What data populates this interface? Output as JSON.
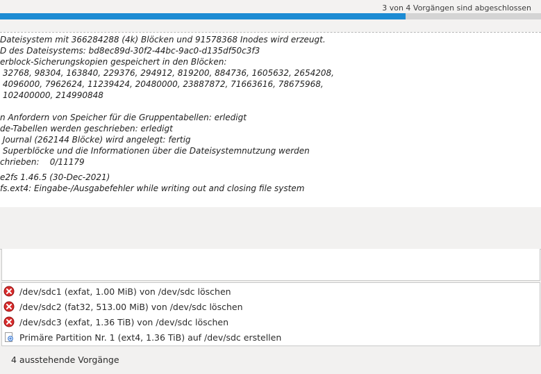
{
  "progress": {
    "status_text": "3 von 4 Vorgängen sind abgeschlossen",
    "fraction": 0.75,
    "color": "#1c8bd3"
  },
  "log": {
    "lines": [
      "Dateisystem mit 366284288 (4k) Blöcken und 91578368 Inodes wird erzeugt.",
      "D des Dateisystems: bd8ec89d-30f2-44bc-9ac0-d135df50c3f3",
      "erblock-Sicherungskopien gespeichert in den Blöcken:",
      " 32768, 98304, 163840, 229376, 294912, 819200, 884736, 1605632, 2654208,",
      " 4096000, 7962624, 11239424, 20480000, 23887872, 71663616, 78675968,",
      " 102400000, 214990848",
      "n Anfordern von Speicher für die Gruppentabellen: erledigt",
      "de-Tabellen werden geschrieben: erledigt",
      " Journal (262144 Blöcke) wird angelegt: fertig",
      " Superblöcke und die Informationen über die Dateisystemnutzung werden",
      "chrieben:    0/11179",
      "e2fs 1.46.5 (30-Dec-2021)",
      "fs.ext4: Eingabe-/Ausgabefehler while writing out and closing file system"
    ]
  },
  "operations": [
    {
      "icon": "delete-icon",
      "label": "/dev/sdc1 (exfat, 1.00 MiB) von /dev/sdc löschen"
    },
    {
      "icon": "delete-icon",
      "label": "/dev/sdc2 (fat32, 513.00 MiB) von /dev/sdc löschen"
    },
    {
      "icon": "delete-icon",
      "label": "/dev/sdc3 (exfat, 1.36 TiB) von /dev/sdc löschen"
    },
    {
      "icon": "new-partition-icon",
      "label": "Primäre Partition Nr. 1 (ext4, 1.36 TiB) auf /dev/sdc erstellen"
    }
  ],
  "pending_label": "4 ausstehende Vorgänge",
  "colors": {
    "delete": "#d92b2b",
    "new": "#3b7bd6"
  }
}
